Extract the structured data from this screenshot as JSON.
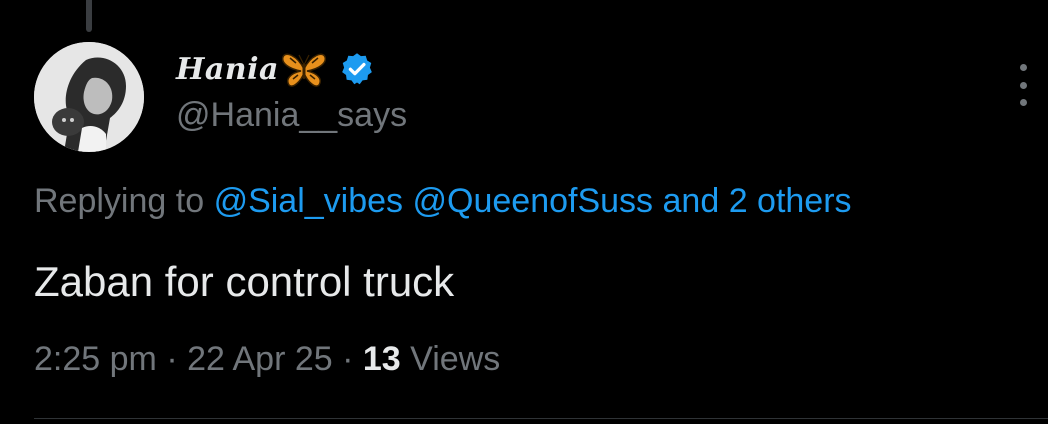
{
  "tweet": {
    "display_name": "Hania",
    "handle": "@Hania__says",
    "replying_prefix": "Replying to",
    "replying_mentions": [
      "@Sial_vibes",
      "@QueenofSuss"
    ],
    "replying_others": "and 2 others",
    "text": "Zaban for control truck",
    "time": "2:25 pm",
    "date": "22 Apr 25",
    "separator": "·",
    "views_count": "13",
    "views_label": "Views"
  },
  "icons": {
    "butterfly": "butterfly-icon",
    "verified": "verified-badge-icon",
    "more": "more-options-icon"
  },
  "colors": {
    "background": "#000000",
    "primary_text": "#e7e9ea",
    "secondary_text": "#71767b",
    "accent": "#1d9bf0",
    "butterfly": "#e8901c"
  }
}
